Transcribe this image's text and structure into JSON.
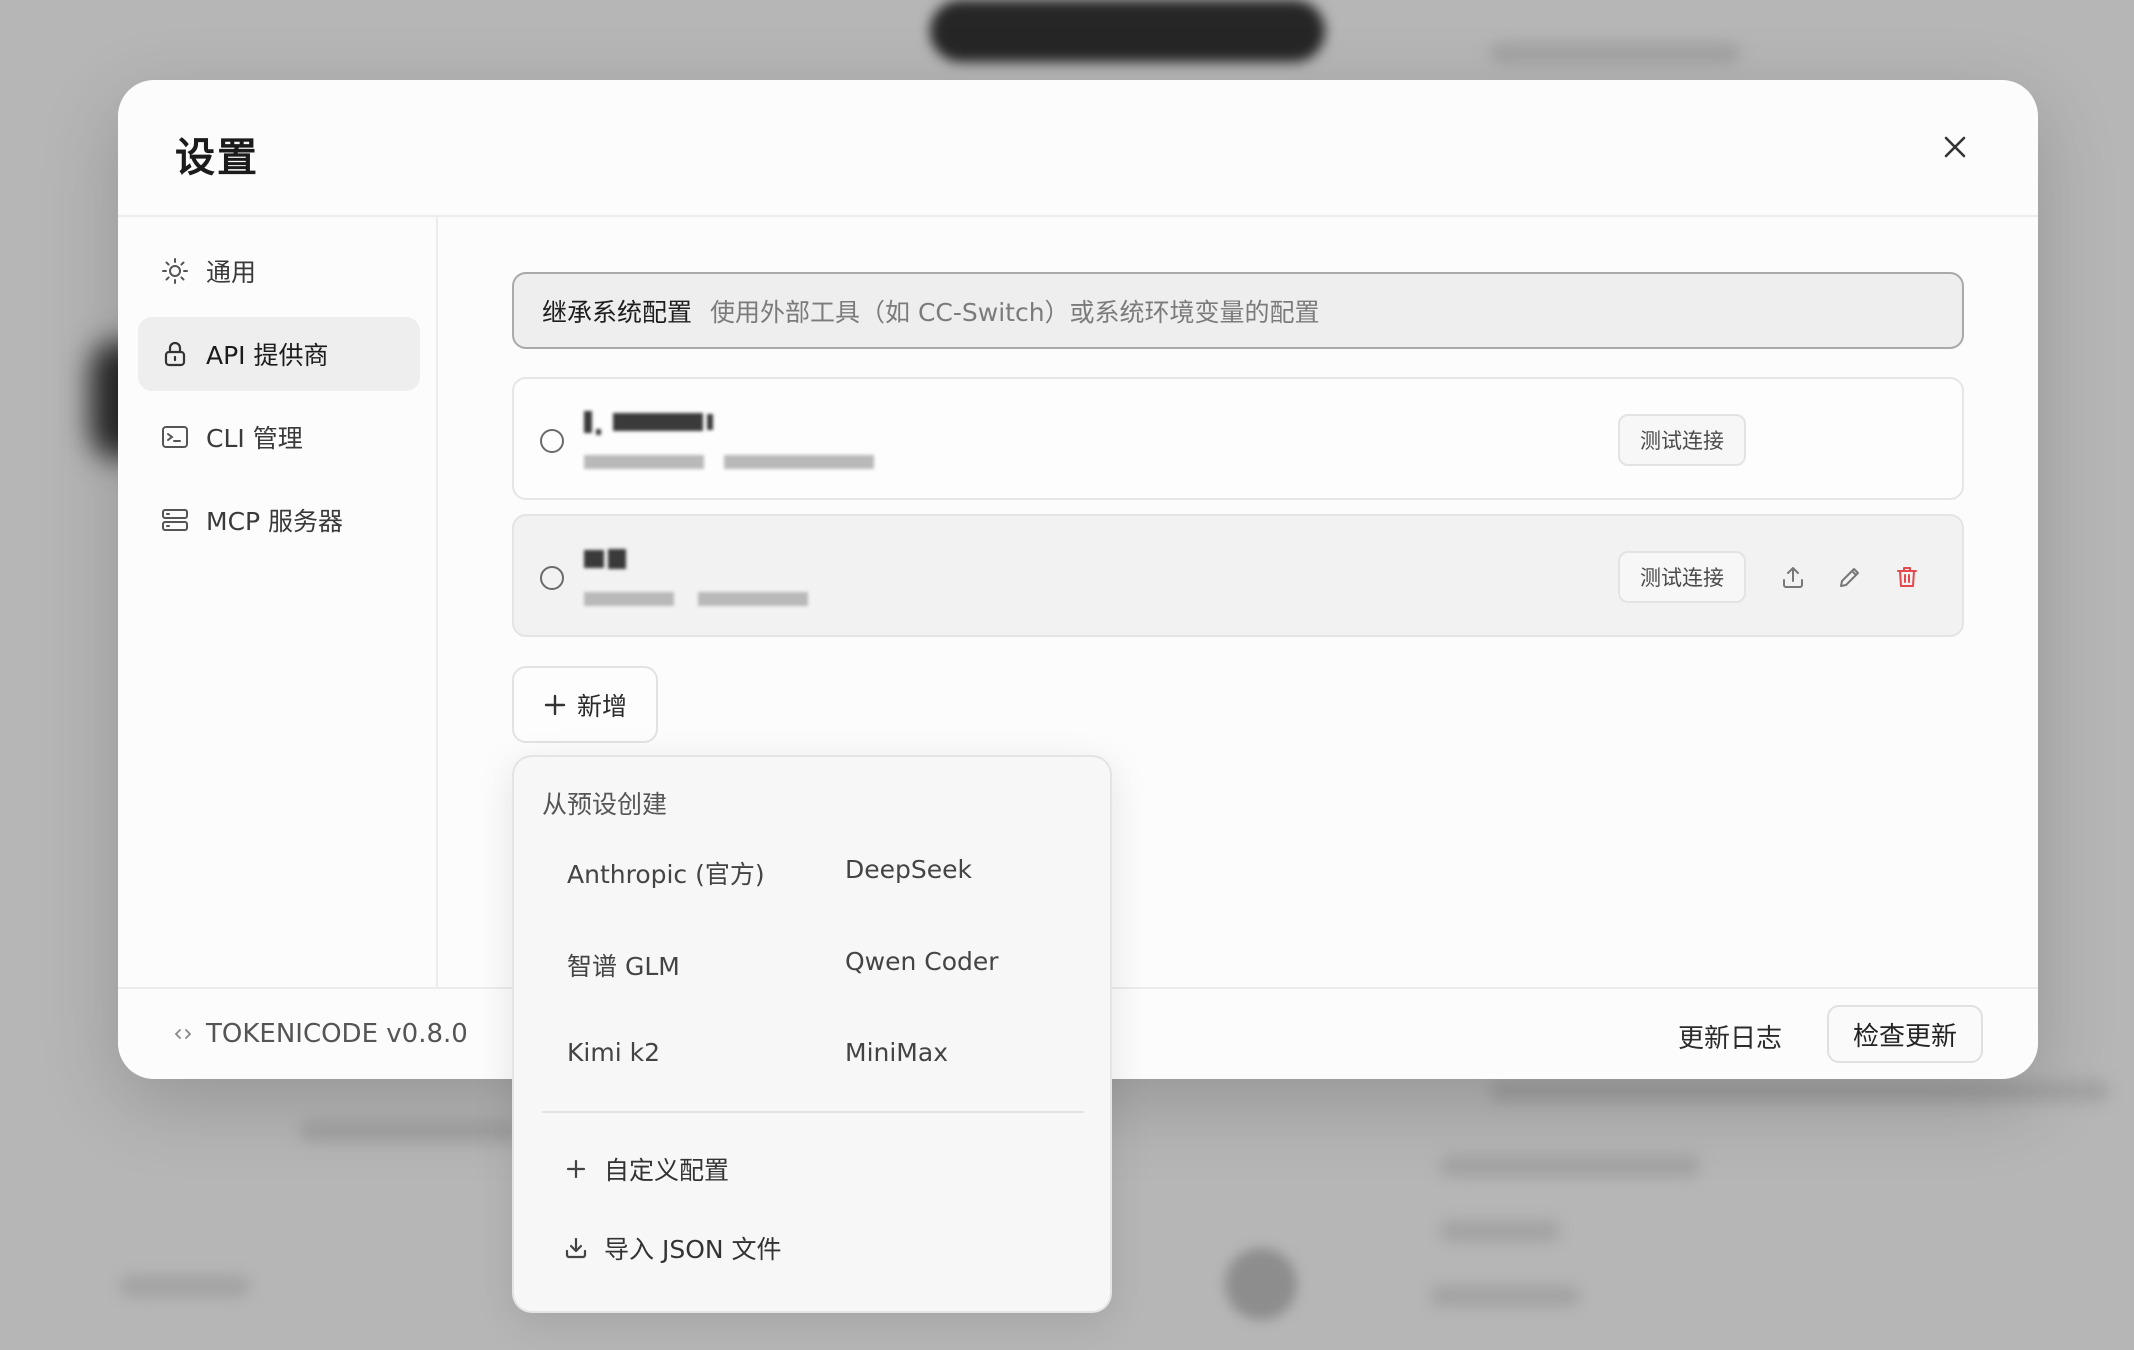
{
  "dialog": {
    "title": "设置"
  },
  "sidebar": {
    "items": [
      {
        "label": "通用",
        "icon": "sun-icon"
      },
      {
        "label": "API 提供商",
        "icon": "lock-icon",
        "active": true
      },
      {
        "label": "CLI 管理",
        "icon": "terminal-icon"
      },
      {
        "label": "MCP 服务器",
        "icon": "server-icon"
      }
    ]
  },
  "inherit": {
    "label": "继承系统配置",
    "description": "使用外部工具（如 CC-Switch）或系统环境变量的配置"
  },
  "providers": [
    {
      "test_label": "测试连接"
    },
    {
      "test_label": "测试连接",
      "actions": [
        "upload-icon",
        "pencil-icon",
        "trash-icon"
      ]
    }
  ],
  "add_button": {
    "label": "新增"
  },
  "dropdown": {
    "title": "从预设创建",
    "presets": [
      "Anthropic (官方)",
      "DeepSeek",
      "智谱 GLM",
      "Qwen Coder",
      "Kimi k2",
      "MiniMax"
    ],
    "actions": [
      {
        "label": "自定义配置",
        "icon": "plus-icon"
      },
      {
        "label": "导入 JSON 文件",
        "icon": "download-icon"
      }
    ]
  },
  "footer": {
    "version": "TOKENICODE v0.8.0",
    "changelog": "更新日志",
    "check_update": "检查更新"
  },
  "colors": {
    "danger": "#e5484d",
    "active_bg": "#eeeeee",
    "text": "#222222"
  }
}
